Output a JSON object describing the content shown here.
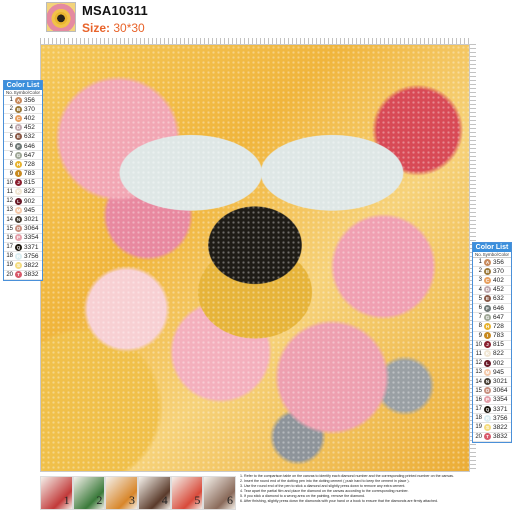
{
  "header": {
    "model": "MSA10311",
    "size_label": "Size:",
    "size_value": "30*30"
  },
  "color_list_left": {
    "title": "Color List",
    "col_no": "No.",
    "col_symbol": "Symbol",
    "col_color": "Color",
    "items": [
      {
        "no": "1",
        "symbol": "A",
        "code": "356",
        "color": "#c88a5c"
      },
      {
        "no": "2",
        "symbol": "B",
        "code": "370",
        "color": "#9c7a3c"
      },
      {
        "no": "3",
        "symbol": "C",
        "code": "402",
        "color": "#e8a060"
      },
      {
        "no": "4",
        "symbol": "D",
        "code": "452",
        "color": "#c0aab0"
      },
      {
        "no": "5",
        "symbol": "E",
        "code": "632",
        "color": "#8a5a48"
      },
      {
        "no": "6",
        "symbol": "F",
        "code": "646",
        "color": "#707a78"
      },
      {
        "no": "7",
        "symbol": "G",
        "code": "647",
        "color": "#a0a898"
      },
      {
        "no": "8",
        "symbol": "H",
        "code": "728",
        "color": "#e8b430"
      },
      {
        "no": "9",
        "symbol": "I",
        "code": "783",
        "color": "#c88a20"
      },
      {
        "no": "10",
        "symbol": "J",
        "code": "815",
        "color": "#8a2030"
      },
      {
        "no": "11",
        "symbol": "K",
        "code": "822",
        "color": "#f0e6d4"
      },
      {
        "no": "12",
        "symbol": "L",
        "code": "902",
        "color": "#6a1a28"
      },
      {
        "no": "13",
        "symbol": "M",
        "code": "945",
        "color": "#f4c8a8"
      },
      {
        "no": "14",
        "symbol": "N",
        "code": "3021",
        "color": "#4a4238"
      },
      {
        "no": "15",
        "symbol": "O",
        "code": "3064",
        "color": "#c89080"
      },
      {
        "no": "16",
        "symbol": "P",
        "code": "3354",
        "color": "#e4a0aa"
      },
      {
        "no": "17",
        "symbol": "Q",
        "code": "3371",
        "color": "#1e1810"
      },
      {
        "no": "18",
        "symbol": "R",
        "code": "3756",
        "color": "#dceef2"
      },
      {
        "no": "19",
        "symbol": "S",
        "code": "3822",
        "color": "#f4dc80"
      },
      {
        "no": "20",
        "symbol": "T",
        "code": "3832",
        "color": "#d85a6a"
      }
    ]
  },
  "color_list_right": {
    "title": "Color List",
    "col_no": "No.",
    "col_symbol": "Symbol",
    "col_color": "Color",
    "items": [
      {
        "no": "1",
        "symbol": "A",
        "code": "356",
        "color": "#c88a5c"
      },
      {
        "no": "2",
        "symbol": "B",
        "code": "370",
        "color": "#9c7a3c"
      },
      {
        "no": "3",
        "symbol": "C",
        "code": "402",
        "color": "#e8a060"
      },
      {
        "no": "4",
        "symbol": "D",
        "code": "452",
        "color": "#c0aab0"
      },
      {
        "no": "5",
        "symbol": "E",
        "code": "632",
        "color": "#8a5a48"
      },
      {
        "no": "6",
        "symbol": "F",
        "code": "646",
        "color": "#707a78"
      },
      {
        "no": "7",
        "symbol": "G",
        "code": "647",
        "color": "#a0a898"
      },
      {
        "no": "8",
        "symbol": "H",
        "code": "728",
        "color": "#e8b430"
      },
      {
        "no": "9",
        "symbol": "I",
        "code": "783",
        "color": "#c88a20"
      },
      {
        "no": "10",
        "symbol": "J",
        "code": "815",
        "color": "#8a2030"
      },
      {
        "no": "11",
        "symbol": "K",
        "code": "822",
        "color": "#f0e6d4"
      },
      {
        "no": "12",
        "symbol": "L",
        "code": "902",
        "color": "#6a1a28"
      },
      {
        "no": "13",
        "symbol": "M",
        "code": "945",
        "color": "#f4c8a8"
      },
      {
        "no": "14",
        "symbol": "N",
        "code": "3021",
        "color": "#4a4238"
      },
      {
        "no": "15",
        "symbol": "O",
        "code": "3064",
        "color": "#c89080"
      },
      {
        "no": "16",
        "symbol": "P",
        "code": "3354",
        "color": "#e4a0aa"
      },
      {
        "no": "17",
        "symbol": "Q",
        "code": "3371",
        "color": "#1e1810"
      },
      {
        "no": "18",
        "symbol": "R",
        "code": "3756",
        "color": "#dceef2"
      },
      {
        "no": "19",
        "symbol": "S",
        "code": "3822",
        "color": "#f4dc80"
      },
      {
        "no": "20",
        "symbol": "T",
        "code": "3832",
        "color": "#d85a6a"
      }
    ]
  },
  "steps": [
    {
      "n": "1",
      "color": "#c23a3a"
    },
    {
      "n": "2",
      "color": "#3a7a3a"
    },
    {
      "n": "3",
      "color": "#d8862a"
    },
    {
      "n": "4",
      "color": "#5a3a2a"
    },
    {
      "n": "5",
      "color": "#d84a3a"
    },
    {
      "n": "6",
      "color": "#8a6a5a"
    }
  ],
  "instructions": [
    "1. Refer to the comparison table on the canvas to identify each diamond number and the corresponding printed number on the canvas.",
    "2. Insert the round end of the dotting pen into the dotting cement ( push hard to keep the cement in place ).",
    "3. Use the round end of the pen to stick a diamond and slightly press down to remove any extra cement.",
    "4. Tear apart the partial film and place the diamond on the canvas according to the corresponding number.",
    "5. If you stick a diamond to a wrong area on the painting, remove the diamond.",
    "6. After finishing, slightly press down the diamonds with your hand or a book to ensure that the diamonds are firmly attached."
  ]
}
